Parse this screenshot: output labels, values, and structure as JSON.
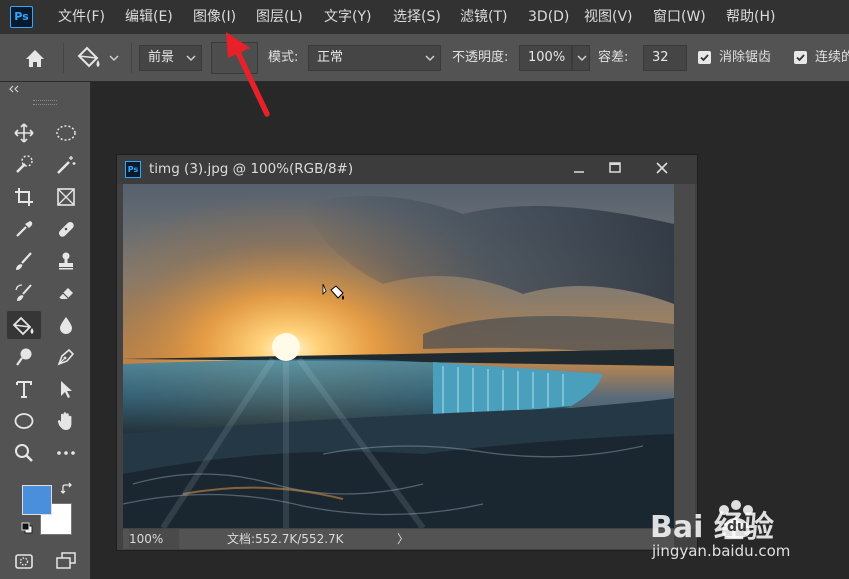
{
  "app": {
    "logo": "Ps"
  },
  "menu": [
    "文件(F)",
    "编辑(E)",
    "图像(I)",
    "图层(L)",
    "文字(Y)",
    "选择(S)",
    "滤镜(T)",
    "3D(D)",
    "视图(V)",
    "窗口(W)",
    "帮助(H)"
  ],
  "options": {
    "fill_source": "前景",
    "mode_label": "模式:",
    "mode_value": "正常",
    "opacity_label": "不透明度:",
    "opacity_value": "100%",
    "tolerance_label": "容差:",
    "tolerance_value": "32",
    "antialias_label": "消除锯齿",
    "antialias_checked": true,
    "contiguous_label": "连续的",
    "contiguous_checked": true
  },
  "toolbar": {
    "foreground_color": "#4a8fdc",
    "background_color": "#ffffff",
    "active_tool": "paint-bucket"
  },
  "document": {
    "title": "timg (3).jpg @ 100%(RGB/8#)",
    "zoom": "100%",
    "doc_info": "文档:552.7K/552.7K",
    "status_arrow": "〉"
  },
  "annotation": {
    "arrow_color": "#e8202a",
    "points_to": "图像(I)"
  },
  "watermark": {
    "brand_text": "Bai 经验",
    "brand_du": "du",
    "url": "jingyan.baidu.com"
  }
}
